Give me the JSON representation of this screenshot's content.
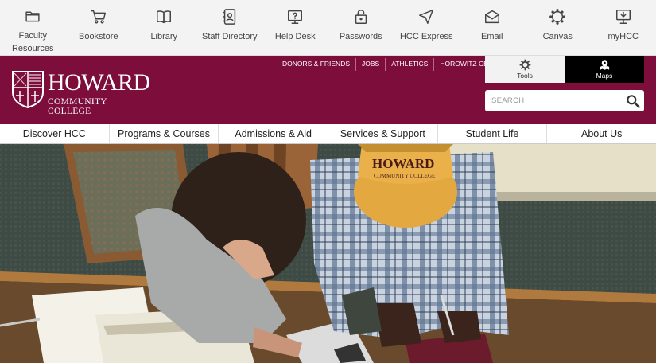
{
  "utility_nav": [
    {
      "label": "Faculty\nResources",
      "icon": "folder-icon"
    },
    {
      "label": "Bookstore",
      "icon": "cart-icon"
    },
    {
      "label": "Library",
      "icon": "book-icon"
    },
    {
      "label": "Staff Directory",
      "icon": "address-book-icon"
    },
    {
      "label": "Help Desk",
      "icon": "monitor-question-icon"
    },
    {
      "label": "Passwords",
      "icon": "lock-icon"
    },
    {
      "label": "HCC Express",
      "icon": "navigation-arrow-icon"
    },
    {
      "label": "Email",
      "icon": "envelope-icon"
    },
    {
      "label": "Canvas",
      "icon": "canvas-icon"
    },
    {
      "label": "myHCC",
      "icon": "monitor-icon"
    }
  ],
  "header": {
    "logo_name": "HOWARD",
    "logo_sub": "COMMUNITY COLLEGE",
    "top_links": [
      "DONORS & FRIENDS",
      "JOBS",
      "ATHLETICS",
      "HOROWITZ CENTER"
    ],
    "tools_label": "Tools",
    "maps_label": "Maps",
    "search_placeholder": "SEARCH",
    "brand_color": "#7d0e3c"
  },
  "main_nav": [
    "Discover HCC",
    "Programs & Courses",
    "Admissions & Aid",
    "Services & Support",
    "Student Life",
    "About Us"
  ],
  "hero": {
    "cap_text_1": "HOWARD",
    "cap_text_2": "COMMUNITY COLLEGE"
  }
}
